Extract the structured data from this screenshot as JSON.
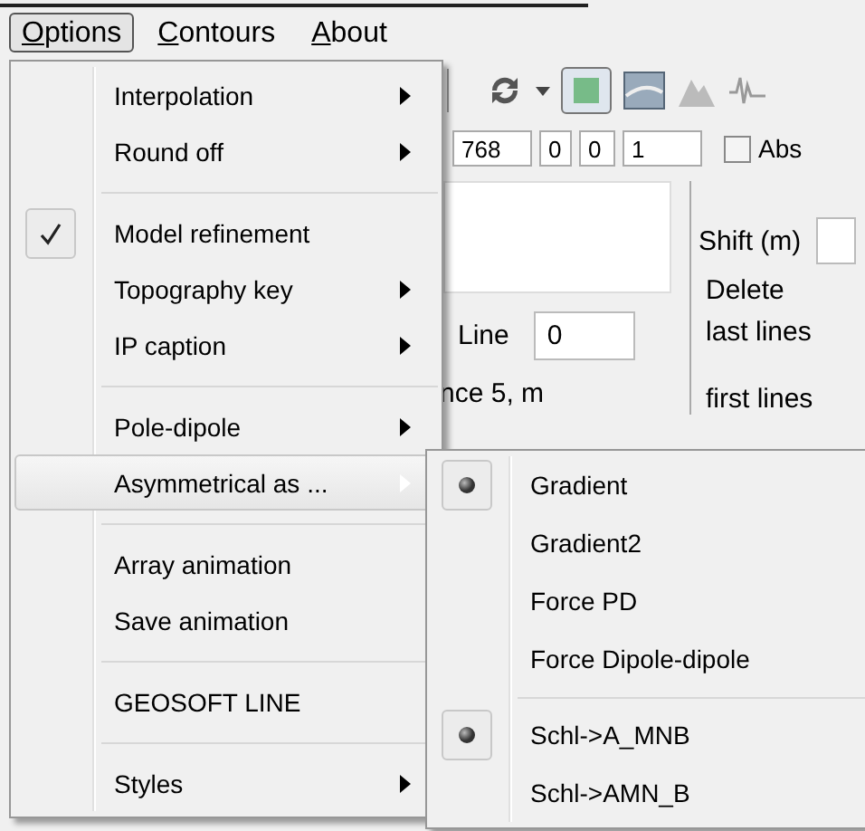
{
  "menubar": [
    {
      "label": "Options",
      "selected": true
    },
    {
      "label": "Contours",
      "selected": false
    },
    {
      "label": "About",
      "selected": false
    }
  ],
  "fields": [
    "768",
    "0",
    "0",
    "1"
  ],
  "abs_checkbox": {
    "label": "Abs",
    "checked": false
  },
  "line": {
    "label": "Line",
    "value": "0"
  },
  "spacing_text": "nce  5, m",
  "shift_label": "Shift (m)",
  "delete_label": "Delete",
  "last_lines_label": "last lines",
  "first_lines_label": "first lines",
  "options_menu": [
    {
      "kind": "item",
      "label": "Interpolation",
      "submenu": true,
      "checked": false,
      "selected": false
    },
    {
      "kind": "item",
      "label": "Round off",
      "submenu": true,
      "checked": false,
      "selected": false
    },
    {
      "kind": "separator"
    },
    {
      "kind": "item",
      "label": "Model refinement",
      "submenu": false,
      "checked": true,
      "selected": false
    },
    {
      "kind": "item",
      "label": "Topography key",
      "submenu": true,
      "checked": false,
      "selected": false
    },
    {
      "kind": "item",
      "label": "IP caption",
      "submenu": true,
      "checked": false,
      "selected": false
    },
    {
      "kind": "separator"
    },
    {
      "kind": "item",
      "label": "Pole-dipole",
      "submenu": true,
      "checked": false,
      "selected": false
    },
    {
      "kind": "item",
      "label": "Asymmetrical as ...",
      "submenu": true,
      "checked": false,
      "selected": true
    },
    {
      "kind": "separator"
    },
    {
      "kind": "item",
      "label": "Array animation",
      "submenu": false,
      "checked": false,
      "selected": false
    },
    {
      "kind": "item",
      "label": "Save animation",
      "submenu": false,
      "checked": false,
      "selected": false
    },
    {
      "kind": "separator"
    },
    {
      "kind": "item",
      "label": "GEOSOFT LINE",
      "submenu": false,
      "checked": false,
      "selected": false
    },
    {
      "kind": "separator"
    },
    {
      "kind": "item",
      "label": "Styles",
      "submenu": true,
      "checked": false,
      "selected": false
    }
  ],
  "asymmetrical_submenu": [
    {
      "kind": "item",
      "label": "Gradient",
      "checked": true
    },
    {
      "kind": "item",
      "label": "Gradient2",
      "checked": false
    },
    {
      "kind": "item",
      "label": "Force PD",
      "checked": false
    },
    {
      "kind": "item",
      "label": "Force Dipole-dipole",
      "checked": false
    },
    {
      "kind": "separator"
    },
    {
      "kind": "item",
      "label": "Schl->A_MNB",
      "checked": true
    },
    {
      "kind": "item",
      "label": "Schl->AMN_B",
      "checked": false
    }
  ]
}
